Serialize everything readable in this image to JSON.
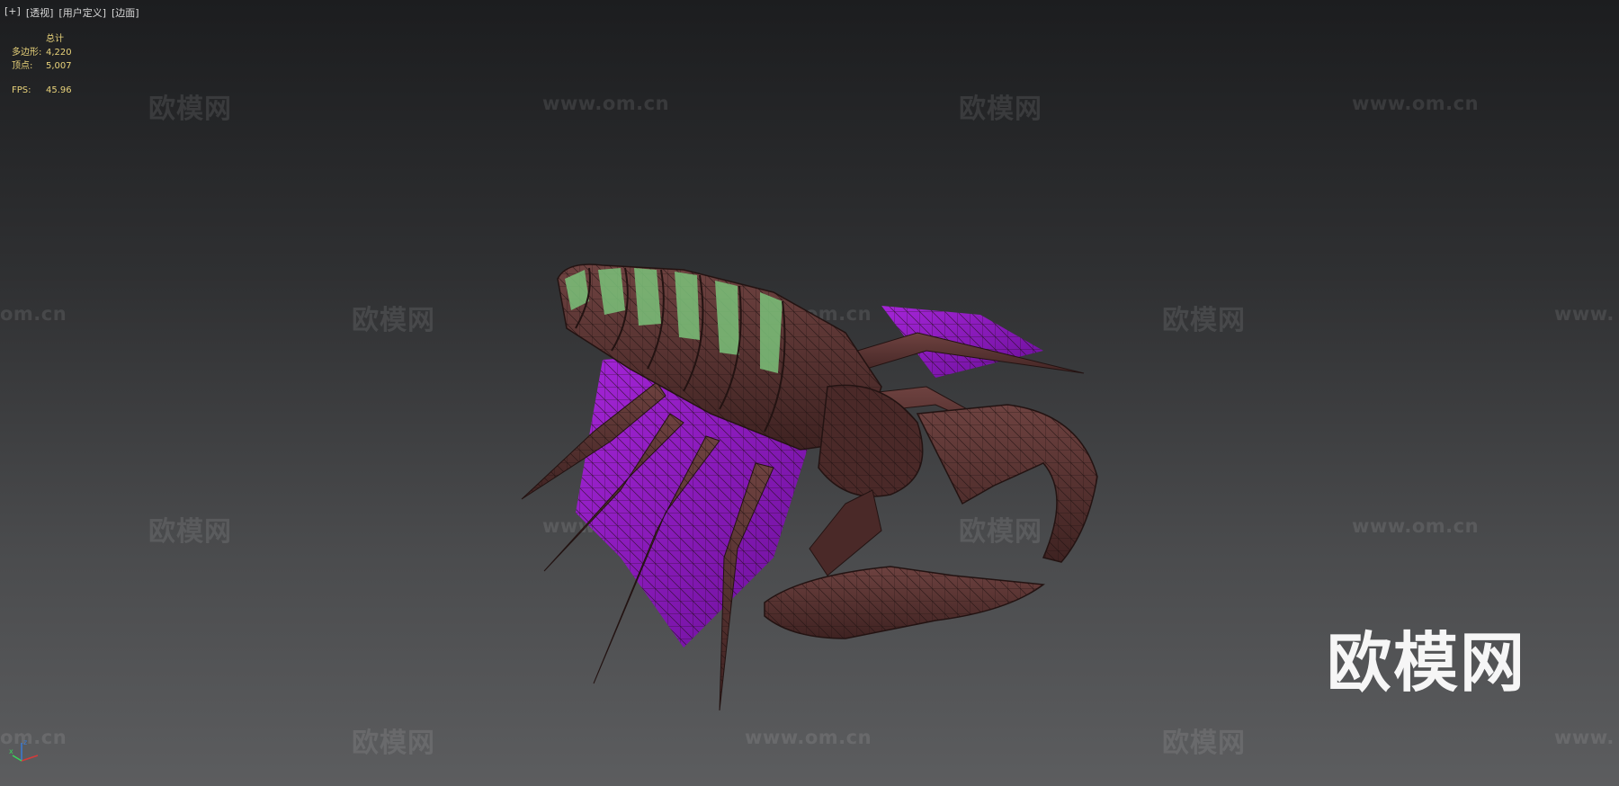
{
  "viewport_menu": {
    "items": [
      "[+]",
      "[透视]",
      "[用户定义]",
      "[边面]"
    ]
  },
  "stats": {
    "header": "总计",
    "polygons_label": "多边形:",
    "polygons_value": "4,220",
    "vertices_label": "顶点:",
    "vertices_value": "5,007",
    "fps_label": "FPS:",
    "fps_value": "45.96"
  },
  "watermarks": {
    "site_name": "欧模网",
    "site_url": "www.om.cn",
    "site_url_left_cut": "om.cn",
    "site_url_right_cut": "www."
  },
  "axis_gizmo": {
    "x_label": "x",
    "z_label": "z"
  },
  "colors": {
    "stat_text": "#e8d27a",
    "menu_text": "#d8d8d8",
    "model_body": "#5a3432",
    "model_membrane": "#9a1fcf",
    "model_highlight": "#7bc27a"
  },
  "icons": [
    "axis-gizmo-icon"
  ]
}
